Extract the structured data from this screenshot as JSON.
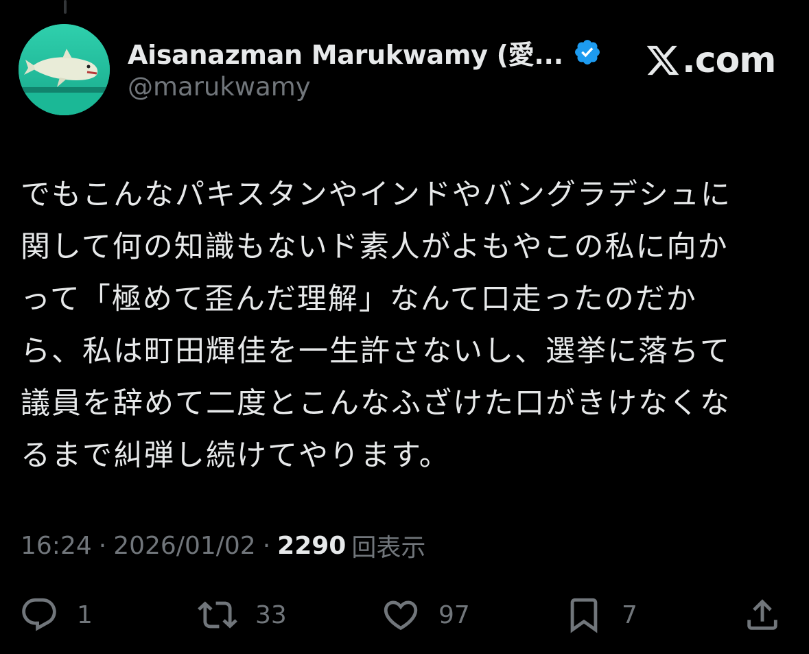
{
  "author": {
    "display_name": "Aisanazman Marukwamy (愛...",
    "handle": "@marukwamy",
    "verified": true,
    "avatar_icon": "dolphin-avatar-icon"
  },
  "brand": {
    "text": ".com",
    "icon": "x-logo-icon"
  },
  "tweet": {
    "lines": [
      "でもこんなパキスタンやインドやバングラデシュに",
      "関して何の知識もないド素人がよもやこの私に向か",
      "って「極めて歪んだ理解」なんて口走ったのだか",
      "ら、私は町田輝佳を一生許さないし、選挙に落ちて",
      "議員を辞めて二度とこんなふざけた口がきけなくな",
      "るまで糾弾し続けてやります。"
    ]
  },
  "meta": {
    "time": "16:24",
    "separator": "·",
    "date": "2026/01/02",
    "views_count": "2290",
    "views_label": "回表示"
  },
  "actions": {
    "reply": {
      "icon": "reply-icon",
      "count": "1"
    },
    "retweet": {
      "icon": "retweet-icon",
      "count": "33"
    },
    "like": {
      "icon": "heart-icon",
      "count": "97"
    },
    "bookmark": {
      "icon": "bookmark-icon",
      "count": "7"
    },
    "share": {
      "icon": "share-icon"
    }
  },
  "colors": {
    "background": "#000000",
    "text": "#e7e9ea",
    "muted": "#71767b",
    "verified_blue": "#1d9bf0",
    "avatar_bg": "#27c7a2"
  }
}
